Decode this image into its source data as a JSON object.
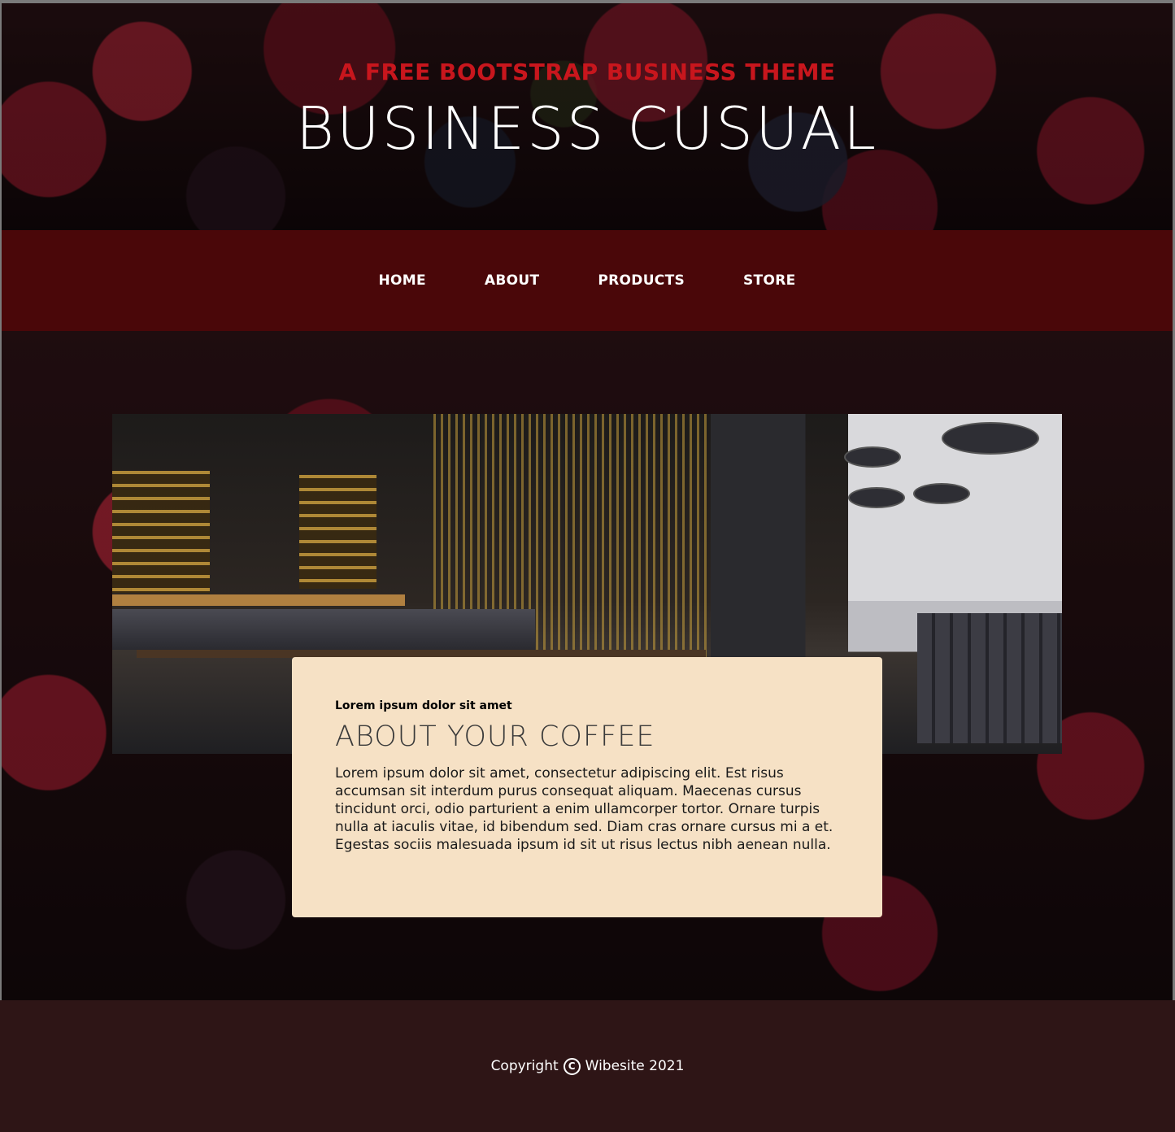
{
  "header": {
    "subtitle": "A FREE BOOTSTRAP BUSINESS THEME",
    "title": "BUSINESS CUSUAL"
  },
  "nav": {
    "items": [
      {
        "label": "HOME"
      },
      {
        "label": "ABOUT"
      },
      {
        "label": "PRODUCTS"
      },
      {
        "label": "STORE"
      }
    ]
  },
  "about": {
    "kicker": "Lorem ipsum dolor sit amet",
    "heading": "ABOUT YOUR COFFEE",
    "body": "Lorem ipsum dolor sit amet, consectetur adipiscing elit. Est risus accumsan sit interdum purus consequat aliquam. Maecenas cursus tincidunt orci, odio parturient a enim ullamcorper tortor. Ornare turpis nulla at iaculis vitae, id bibendum sed. Diam cras ornare cursus mi a et. Egestas sociis malesuada ipsum id sit ut risus lectus nibh aenean nulla."
  },
  "footer": {
    "copyright_icon": "C",
    "prefix": "Copyright",
    "suffix": "Wibesite 2021"
  },
  "colors": {
    "accent_red": "#c8161d",
    "nav_bg": "#4a0709",
    "card_bg": "#f6e1c5",
    "footer_bg": "#2e1516"
  }
}
